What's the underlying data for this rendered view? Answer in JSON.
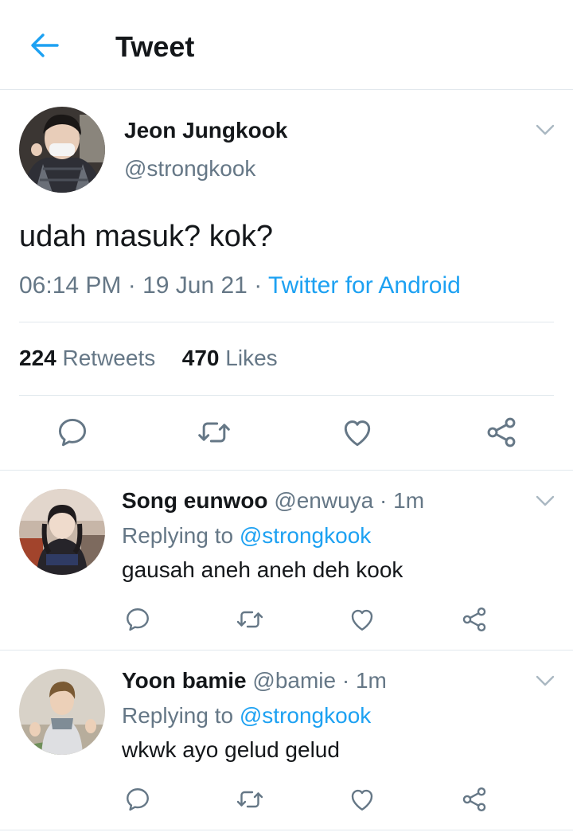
{
  "header": {
    "title": "Tweet"
  },
  "tweet": {
    "author_name": "Jeon Jungkook",
    "author_handle": "@strongkook",
    "text": "udah masuk? kok?",
    "time": "06:14 PM",
    "date": "19 Jun 21",
    "source": "Twitter for Android",
    "retweets_count": "224",
    "retweets_label": "Retweets",
    "likes_count": "470",
    "likes_label": "Likes"
  },
  "replies": [
    {
      "name": "Song eunwoo",
      "handle": "@enwuya",
      "time": "1m",
      "replying_prefix": "Replying to",
      "replying_to": "@strongkook",
      "text": "gausah aneh aneh deh kook"
    },
    {
      "name": "Yoon bamie",
      "handle": "@bamie",
      "time": "1m",
      "replying_prefix": "Replying to",
      "replying_to": "@strongkook",
      "text": "wkwk ayo gelud gelud"
    }
  ],
  "icons": {
    "back": "arrow-left-icon",
    "menu": "chevron-down-icon",
    "reply": "reply-icon",
    "retweet": "retweet-icon",
    "like": "heart-icon",
    "share": "share-icon"
  },
  "colors": {
    "accent": "#1da1f2",
    "text": "#14171a",
    "secondary": "#657786",
    "divider": "#e1e8ed",
    "icon": "#657786"
  }
}
